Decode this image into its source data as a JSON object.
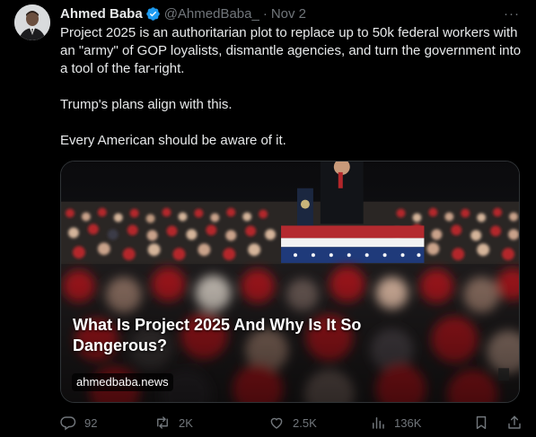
{
  "tweet": {
    "author": {
      "name": "Ahmed Baba",
      "handle": "@AhmedBaba_",
      "verified_icon": "verified-badge-icon",
      "separator": "·",
      "date": "Nov 2"
    },
    "more_icon_glyph": "···",
    "text": {
      "paragraph_1": "Project 2025 is an authoritarian plot to replace up to 50k federal workers with an \"army\" of GOP loyalists, dismantle agencies, and turn the government into a tool of the far-right.",
      "paragraph_2": "Trump's plans align with this.",
      "paragraph_3": "Every American should be aware of it."
    },
    "card": {
      "title": "What Is Project 2025 And Why Is It So Dangerous?",
      "domain": "ahmedbaba.news",
      "image_description_icon": "rally-crowd-photo"
    },
    "actions": {
      "replies": "92",
      "reposts": "2K",
      "likes": "2.5K",
      "views": "136K"
    },
    "colors": {
      "background": "#000000",
      "text_primary": "#e7e9ea",
      "text_secondary": "#71767b",
      "verified": "#1d9bf0",
      "border": "#2f3336"
    }
  }
}
